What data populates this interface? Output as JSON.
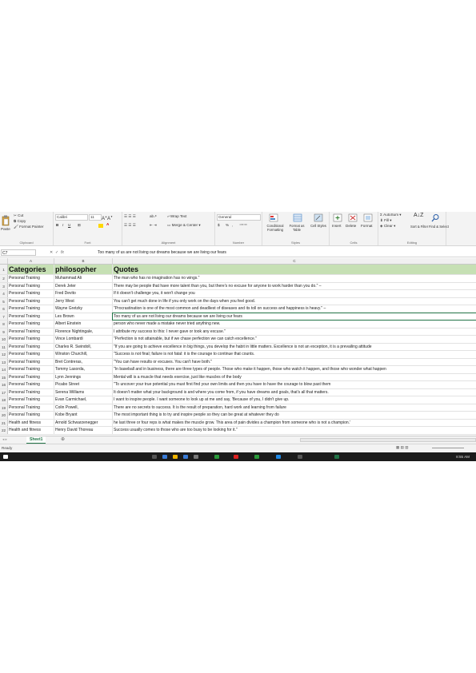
{
  "ribbon": {
    "clipboard": {
      "paste": "Paste",
      "cut": "Cut",
      "copy": "Copy",
      "format_painter": "Format Painter",
      "label": "Clipboard"
    },
    "font": {
      "name": "Calibri",
      "size": "11",
      "bold": "B",
      "italic": "I",
      "underline": "U",
      "label": "Font"
    },
    "alignment": {
      "wrap_text": "Wrap Text",
      "merge_center": "Merge & Center",
      "label": "Alignment"
    },
    "number": {
      "format": "General",
      "currency": "$",
      "percent": "%",
      "comma": ",",
      "label": "Number"
    },
    "styles": {
      "conditional": "Conditional Formatting",
      "format_table": "Format as Table",
      "cell_styles": "Cell Styles",
      "label": "Styles"
    },
    "cells": {
      "insert": "Insert",
      "delete": "Delete",
      "format": "Format",
      "label": "Cells"
    },
    "editing": {
      "autosum": "AutoSum",
      "fill": "Fill",
      "clear": "Clear",
      "sort_filter": "Sort & Filter",
      "find_select": "Find & Select",
      "label": "Editing"
    }
  },
  "formula_bar": {
    "name_box": "C7",
    "fx": "fx",
    "content": "Too many of us are not living our dreams because we are living our fears"
  },
  "columns": [
    "A",
    "B",
    "C"
  ],
  "header_row": {
    "num": "1",
    "a": "Categories",
    "b": "philosopher",
    "c": "Quotes"
  },
  "rows": [
    {
      "num": "2",
      "a": "Personal Training",
      "b": "Muhammad Ali",
      "c": "The man who has no imagination has no wings.\""
    },
    {
      "num": "3",
      "a": "Personal Training",
      "b": "Derek Jeter",
      "c": "There may be people that have more talent than you, but there's no excuse for anyone to work harder than you do.\" –"
    },
    {
      "num": "4",
      "a": "Personal Training",
      "b": "Fred Devito",
      "c": "If it doesn't challenge you, it won't change you"
    },
    {
      "num": "5",
      "a": "Personal Training",
      "b": "Jerry West",
      "c": "You can't get much done in life if you only work on the days when you feel good."
    },
    {
      "num": "6",
      "a": "Personal Training",
      "b": "Wayne Gretzky",
      "c": "\"Procrastination is one of the most common and deadliest of diseases and its toll on success and happiness is heavy.\" –"
    },
    {
      "num": "7",
      "a": "Personal Training",
      "b": "Les Brown",
      "c": "Too many of us are not living our dreams because we are living our fears"
    },
    {
      "num": "8",
      "a": "Personal Training",
      "b": "Albert Einstein",
      "c": " person who never made a mistake never tried anything new."
    },
    {
      "num": "9",
      "a": "Personal Training",
      "b": "Florence Nightingale,",
      "c": "I attribute my success to this: I never gave or took any excuse.\""
    },
    {
      "num": "10",
      "a": "Personal Training",
      "b": "Vince Lombardi",
      "c": "\"Perfection is not attainable, but if we chase perfection we can catch excellence.\""
    },
    {
      "num": "11",
      "a": "Personal Training",
      "b": "Charles R. Swindoll,",
      "c": "\"If you are going to achieve excellence in big things, you develop the habit in little matters. Excellence is not an exception, it is a prevailing attitude"
    },
    {
      "num": "12",
      "a": "Personal Training",
      "b": "Winston Churchill,",
      "c": "\"Success is not final; failure is not fatal: it is the courage to continue that counts."
    },
    {
      "num": "13",
      "a": "Personal Training",
      "b": "Bret Contreras,",
      "c": "\"You can have results or excuses. You can't have both.\""
    },
    {
      "num": "14",
      "a": "Personal Training",
      "b": "Tommy Lasorda,",
      "c": "\"In baseball and in business, there are three types of people. Those who make it happen, those who watch it happen, and those who wonder what happen"
    },
    {
      "num": "15",
      "a": "Personal Training",
      "b": "Lynn Jennings",
      "c": "Mental will is a muscle that needs exercise, just like muscles of the body"
    },
    {
      "num": "16",
      "a": "Personal Training",
      "b": "Picabo Street",
      "c": "\"To uncover your true potential you must first find your own limits and then you have to have the courage to blow past them"
    },
    {
      "num": "17",
      "a": "Personal Training",
      "b": "Serena Williams",
      "c": "It doesn't matter what your background is and where you come from, if you have dreams and goals, that's all that matters."
    },
    {
      "num": "18",
      "a": "Personal Training",
      "b": "Evan Carmichael,",
      "c": "I want to inspire people. I want someone to look up at me and say, 'Because of you, I didn't give up."
    },
    {
      "num": "19",
      "a": "Personal Training",
      "b": "Colin Powell,",
      "c": "There are no secrets to success. It is the result of preparation, hard work and learning from failure"
    },
    {
      "num": "20",
      "a": "Personal Training",
      "b": "Kobe Bryant",
      "c": "The most important thing is to try and inspire people so they can be great at whatever they do"
    },
    {
      "num": "21",
      "a": "Health and fitness",
      "b": "Arnold Schwarzenegger",
      "c": "he last three or four reps is what makes the muscle grow. This area of pain divides a champion from someone who is not a champion.'"
    },
    {
      "num": "22",
      "a": "Health and fitness",
      "b": "Henry David Thoreau",
      "c": "Success usually comes to those who are too busy to be looking for it.\""
    }
  ],
  "sheet_tab": "Sheet1",
  "add_sheet": "⊕",
  "status": "Ready",
  "clock": "8:55 AM",
  "colors": {
    "header_fill": "#c6e0b4",
    "excel_green": "#217346"
  }
}
